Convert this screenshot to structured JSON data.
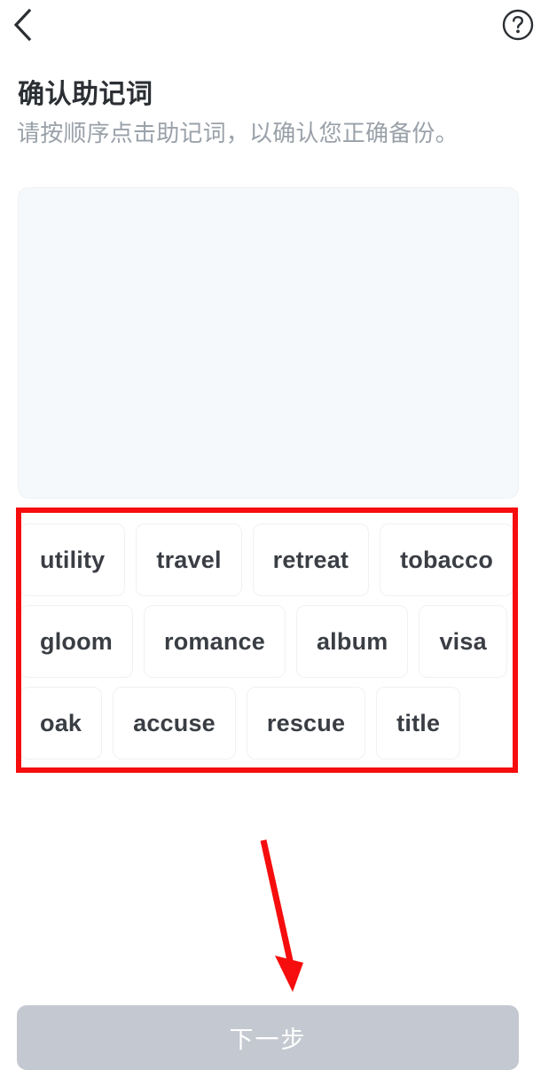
{
  "navbar": {
    "back_icon": "chevron-left-icon",
    "help_icon": "question-mark-circle-icon"
  },
  "header": {
    "title": "确认助记词",
    "subtitle": "请按顺序点击助记词，以确认您正确备份。"
  },
  "answer_panel": {
    "selected_words": [],
    "background_color": "#f6f9fb"
  },
  "word_bank": {
    "rows": [
      [
        "utility",
        "travel",
        "retreat",
        "tobacco"
      ],
      [
        "gloom",
        "romance",
        "album",
        "visa"
      ],
      [
        "oak",
        "accuse",
        "rescue",
        "title"
      ]
    ],
    "words": [
      "utility",
      "travel",
      "retreat",
      "tobacco",
      "gloom",
      "romance",
      "album",
      "visa",
      "oak",
      "accuse",
      "rescue",
      "title"
    ]
  },
  "annotations": {
    "highlight_color": "#f60d0d",
    "rect_target": "word-bank",
    "arrow_target": "next-button"
  },
  "footer": {
    "next_label": "下一步",
    "next_disabled": true,
    "disabled_color": "#c4c9d1"
  }
}
